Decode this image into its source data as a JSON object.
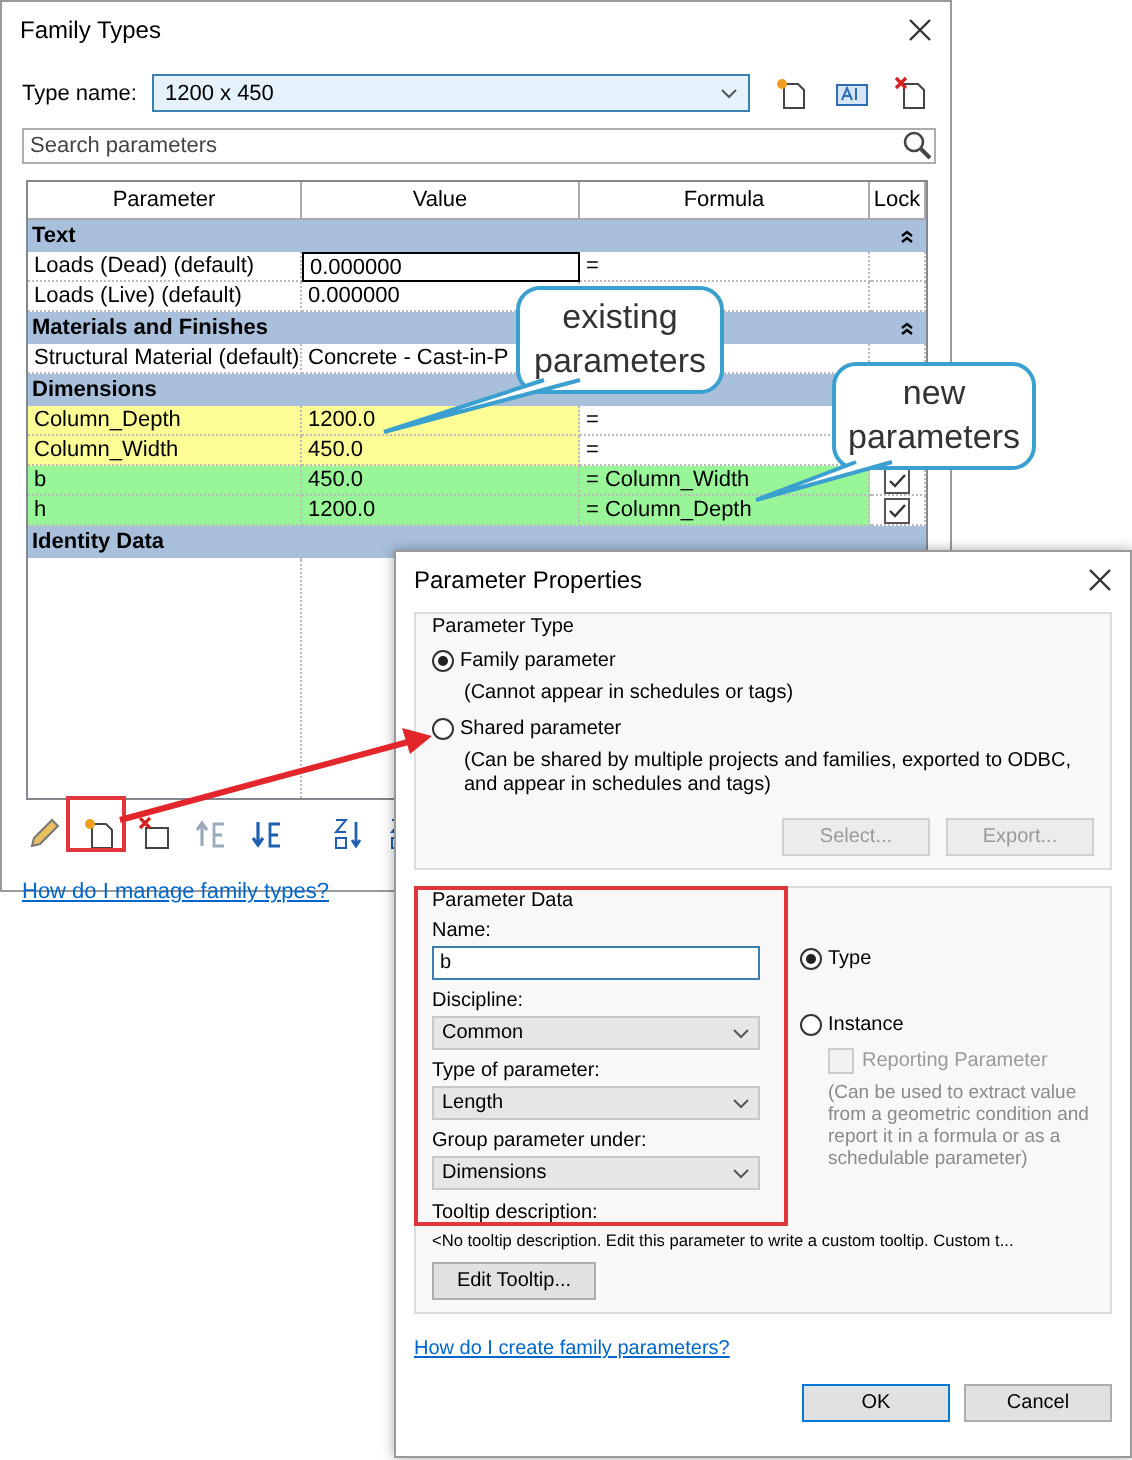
{
  "family_types": {
    "title": "Family Types",
    "type_name": {
      "label": "Type name:",
      "value": "1200 x 450"
    },
    "search": {
      "placeholder": "Search parameters"
    },
    "table": {
      "columns": [
        "Parameter",
        "Value",
        "Formula",
        "Lock"
      ],
      "groups": [
        {
          "name": "Text",
          "expanded": true,
          "rows": [
            {
              "parameter": "Loads (Dead) (default)",
              "value": "0.000000",
              "formula": "=",
              "focused": true
            },
            {
              "parameter": "Loads (Live) (default)",
              "value": "0.000000"
            }
          ]
        },
        {
          "name": "Materials and Finishes",
          "expanded": true,
          "rows": [
            {
              "parameter": "Structural Material (default)",
              "value": "Concrete - Cast-in-P"
            }
          ]
        },
        {
          "name": "Dimensions",
          "rows": [
            {
              "parameter": "Column_Depth",
              "value": "1200.0",
              "formula": "=",
              "color": "#fdfd96"
            },
            {
              "parameter": "Column_Width",
              "value": "450.0",
              "formula": "=",
              "color": "#fdfd96"
            },
            {
              "parameter": "b",
              "value": "450.0",
              "formula": "= Column_Width",
              "color": "#98f598",
              "locked": true
            },
            {
              "parameter": "h",
              "value": "1200.0",
              "formula": "= Column_Depth",
              "color": "#98f598",
              "locked": true
            }
          ]
        },
        {
          "name": "Identity Data"
        }
      ]
    },
    "help_link": "How do I manage family types?"
  },
  "callouts": [
    {
      "text": "existing parameters"
    },
    {
      "text": "new parameters"
    }
  ],
  "parameter_properties": {
    "title": "Parameter Properties",
    "parameter_type": {
      "legend": "Parameter Type",
      "options": [
        {
          "label": "Family parameter",
          "note": "(Cannot appear in schedules or tags)",
          "selected": true
        },
        {
          "label": "Shared parameter",
          "note": "(Can be shared by multiple projects and families, exported to ODBC, and appear in schedules and tags)",
          "selected": false
        }
      ],
      "buttons": [
        {
          "label": "Select...",
          "disabled": true
        },
        {
          "label": "Export...",
          "disabled": true
        }
      ]
    },
    "parameter_data": {
      "legend": "Parameter Data",
      "name": {
        "label": "Name:",
        "value": "b"
      },
      "dropdowns": [
        {
          "label": "Discipline:",
          "value": "Common"
        },
        {
          "label": "Type of parameter:",
          "value": "Length"
        },
        {
          "label": "Group parameter under:",
          "value": "Dimensions"
        }
      ],
      "scope": [
        {
          "label": "Type",
          "selected": true
        },
        {
          "label": "Instance",
          "selected": false
        }
      ],
      "reporting": {
        "label": "Reporting Parameter",
        "checked": false,
        "disabled": true,
        "note": "(Can be used to extract value from a geometric condition and report it in a formula or as a schedulable parameter)"
      },
      "tooltip": {
        "label": "Tooltip description:",
        "text": "<No tooltip description. Edit this parameter to write a custom tooltip. Custom t...",
        "button": "Edit Tooltip..."
      }
    },
    "help_link": "How do I create family parameters?",
    "buttons": [
      {
        "label": "OK",
        "default": true
      },
      {
        "label": "Cancel",
        "default": false
      }
    ]
  }
}
